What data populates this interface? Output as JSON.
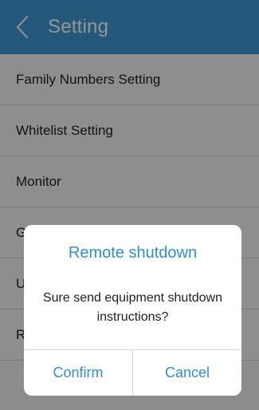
{
  "colors": {
    "navbar_bg": "#3f9ad6",
    "navbar_text": "#ffffff",
    "accent": "#2f8fd8"
  },
  "header": {
    "back_icon": "chevron-left-icon",
    "title": "Setting"
  },
  "settings_list": {
    "items": [
      {
        "label": "Family Numbers Setting"
      },
      {
        "label": "Whitelist Setting"
      },
      {
        "label": "Monitor"
      },
      {
        "label": "G"
      },
      {
        "label": "U"
      },
      {
        "label": "R"
      }
    ]
  },
  "dialog": {
    "title": "Remote shutdown",
    "message": "Sure send equipment shutdown instructions?",
    "confirm_label": "Confirm",
    "cancel_label": "Cancel"
  }
}
